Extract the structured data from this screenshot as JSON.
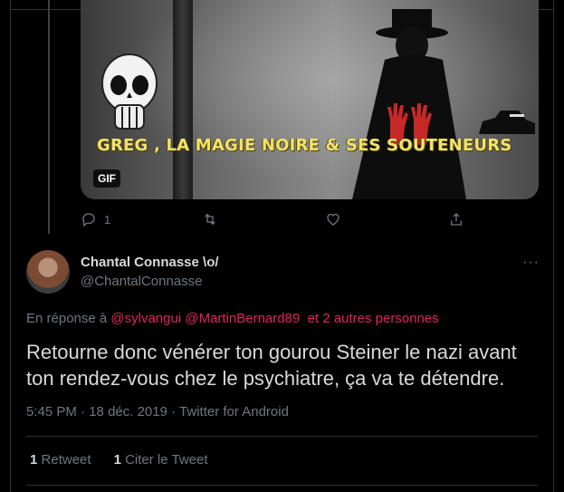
{
  "gif": {
    "caption": "GREG , LA MAGIE NOIRE & SES SOUTENEURS",
    "badge": "GIF"
  },
  "parent_actions": {
    "reply_count": "1",
    "icons": [
      "reply-icon",
      "retweet-icon",
      "like-icon",
      "share-icon"
    ]
  },
  "tweet": {
    "display_name": "Chantal Connasse \\o/",
    "handle": "@ChantalConnasse",
    "more": "···",
    "reply_prefix": "En réponse à",
    "mentions": [
      "@sylvangui",
      "@MartinBernard89"
    ],
    "others": "et 2 autres personnes",
    "text": "Retourne donc vénérer ton gourou Steiner le nazi avant ton rendez-vous chez le psychiatre, ça va te détendre.",
    "time": "5:45 PM",
    "date": "18 déc. 2019",
    "source": "Twitter for Android",
    "dot": "·"
  },
  "stats": {
    "retweets_count": "1",
    "retweets_label": "Retweet",
    "quotes_count": "1",
    "quotes_label": "Citer le Tweet"
  },
  "colors": {
    "background": "#000000",
    "mention": "#e0245e",
    "muted": "#6e767d",
    "text": "#d9d9d9"
  }
}
